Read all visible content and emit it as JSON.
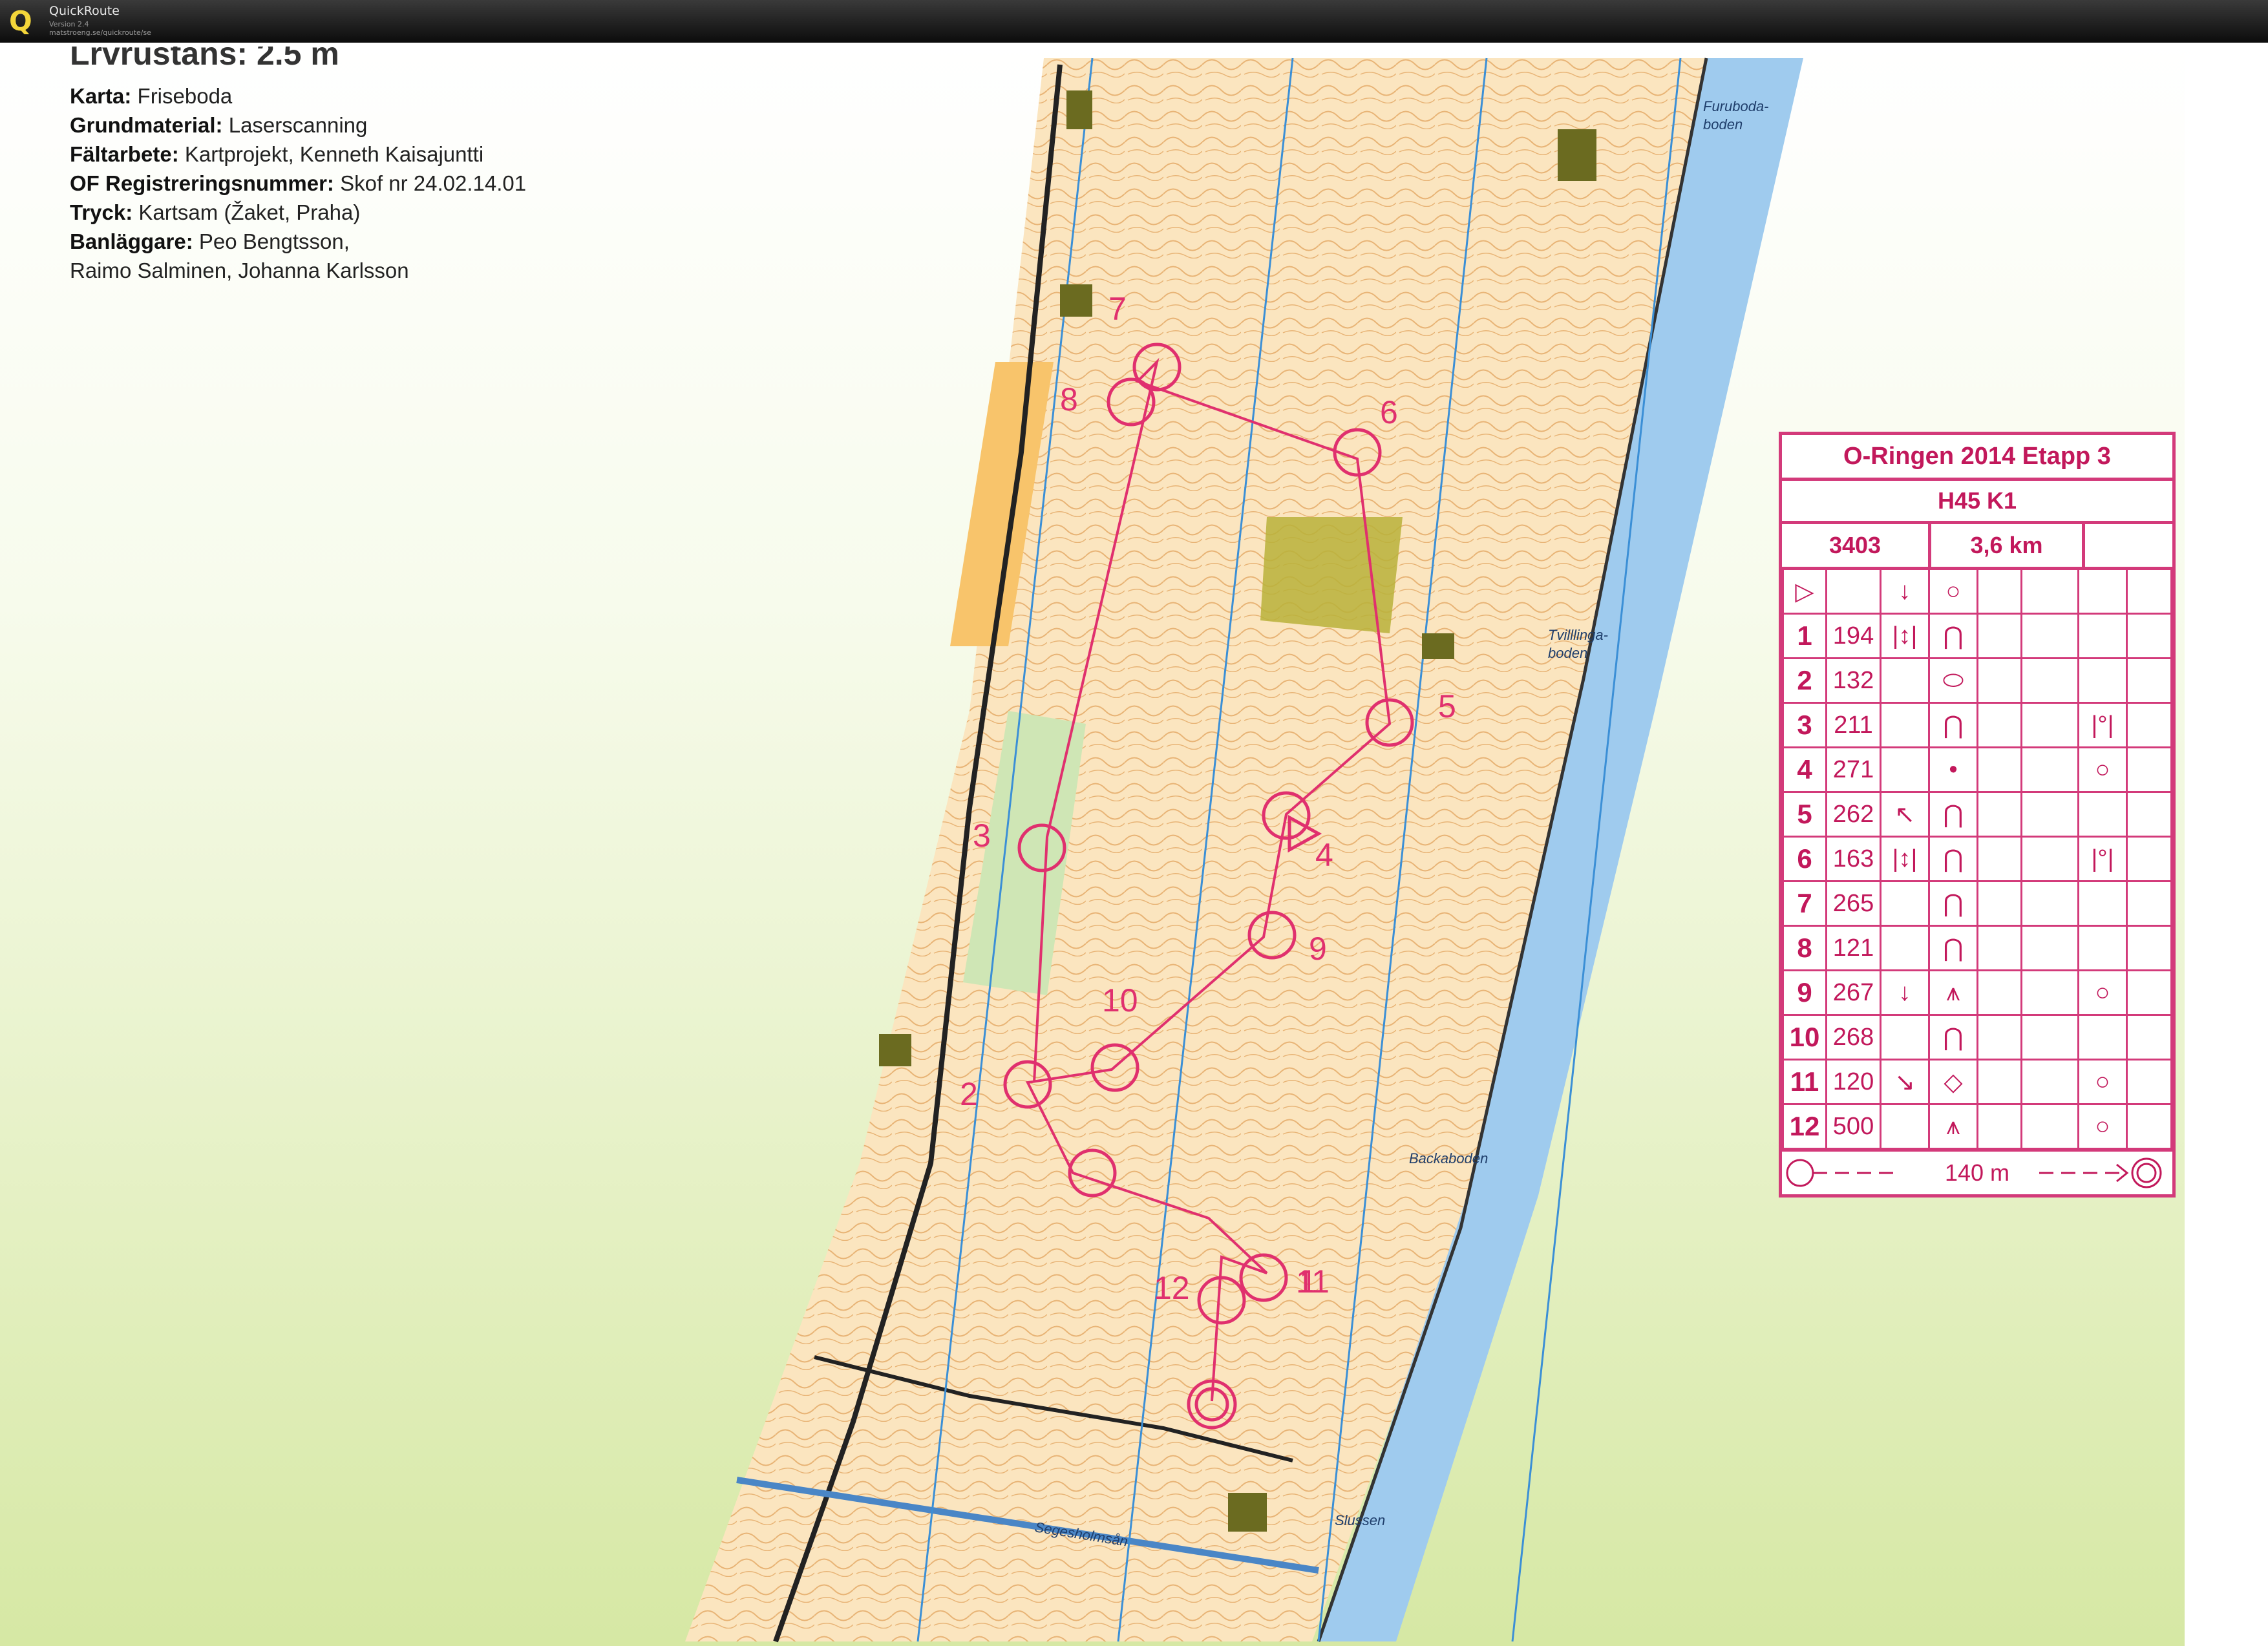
{
  "window": {
    "app_name": "QuickRoute",
    "version": "Version 2.4",
    "url": "matstroeng.se/quickroute/se"
  },
  "map_info": {
    "heading_partial": "Lrvrustans: 2.5 m",
    "rows": [
      {
        "key": "Karta:",
        "value": "Friseboda"
      },
      {
        "key": "Grundmaterial:",
        "value": "Laserscanning"
      },
      {
        "key": "Fältarbete:",
        "value": "Kartprojekt, Kenneth Kaisajuntti"
      },
      {
        "key": "OF Registreringsnummer:",
        "value": "Skof nr 24.02.14.01"
      },
      {
        "key": "Tryck:",
        "value": "Kartsam (Žaket, Praha)"
      },
      {
        "key": "Banläggare:",
        "value": "Peo Bengtsson,"
      },
      {
        "key": "",
        "value": "Raimo Salminen, Johanna Karlsson"
      }
    ]
  },
  "place_names": {
    "furuboda_1": "Furuboda-",
    "furuboda_2": "boden",
    "tvillinga_1": "Tvilllinga-",
    "tvillinga_2": "boden",
    "backaboden": "Backaboden",
    "slussen": "Slussen",
    "segesholmsan": "Segesholmsån"
  },
  "control_labels": {
    "c1": "1",
    "c2": "2",
    "c3": "3",
    "c4": "4",
    "c5": "5",
    "c6": "6",
    "c7": "7",
    "c8": "8",
    "c9": "9",
    "c10": "10",
    "c11": "11",
    "c12": "12"
  },
  "control_description": {
    "title": "O-Ringen 2014 Etapp 3",
    "class": "H45 K1",
    "course_number": "3403",
    "length": "3,6 km",
    "start_symbols": [
      "▷",
      "",
      "↓",
      "○",
      "",
      "",
      "",
      ""
    ],
    "controls": [
      {
        "n": "1",
        "code": "194",
        "dir": "|↕|",
        "feature": "⋂",
        "loc": ""
      },
      {
        "n": "2",
        "code": "132",
        "dir": "",
        "feature": "⬭",
        "loc": ""
      },
      {
        "n": "3",
        "code": "211",
        "dir": "",
        "feature": "⋂",
        "loc": "|°|"
      },
      {
        "n": "4",
        "code": "271",
        "dir": "",
        "feature": "•",
        "loc": "○"
      },
      {
        "n": "5",
        "code": "262",
        "dir": "↖",
        "feature": "⋂",
        "loc": ""
      },
      {
        "n": "6",
        "code": "163",
        "dir": "|↕|",
        "feature": "⋂",
        "loc": "|°|"
      },
      {
        "n": "7",
        "code": "265",
        "dir": "",
        "feature": "⋂",
        "loc": ""
      },
      {
        "n": "8",
        "code": "121",
        "dir": "",
        "feature": "⋂",
        "loc": ""
      },
      {
        "n": "9",
        "code": "267",
        "dir": "↓",
        "feature": "⩚",
        "loc": "○"
      },
      {
        "n": "10",
        "code": "268",
        "dir": "",
        "feature": "⋂",
        "loc": ""
      },
      {
        "n": "11",
        "code": "120",
        "dir": "↘",
        "feature": "◇",
        "loc": "○"
      },
      {
        "n": "12",
        "code": "500",
        "dir": "",
        "feature": "⩚",
        "loc": "○"
      }
    ],
    "finish_distance": "140 m"
  }
}
